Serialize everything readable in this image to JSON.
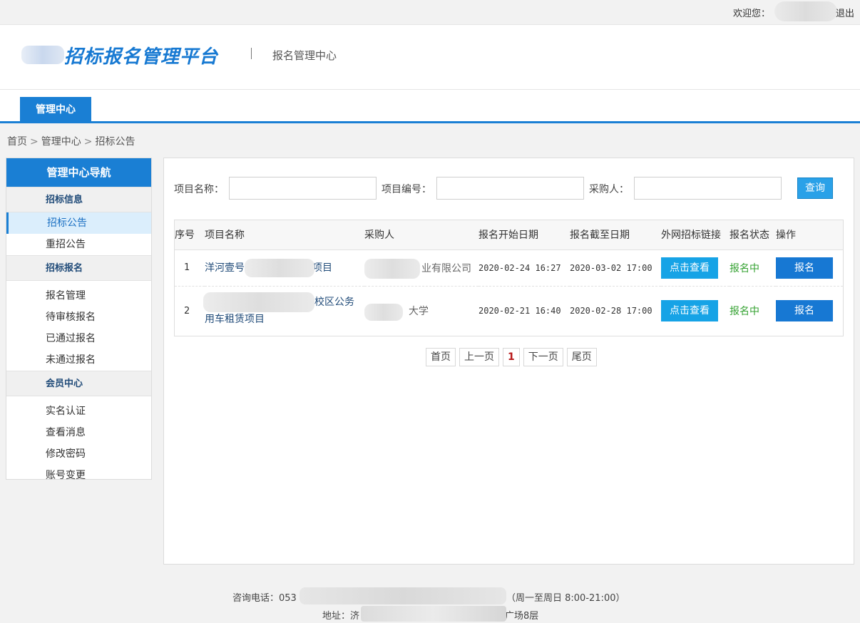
{
  "topbar": {
    "welcome": "欢迎您：",
    "logout": "退出"
  },
  "header": {
    "logo_title": "招标报名管理平台",
    "sub_title": "报名管理中心"
  },
  "nav": {
    "tab": "管理中心"
  },
  "breadcrumb": {
    "home": "首页",
    "center": "管理中心",
    "current": "招标公告",
    "separator": ">"
  },
  "sidebar": {
    "title": "管理中心导航",
    "groups": [
      {
        "title": "招标信息",
        "items": [
          "招标公告",
          "重招公告"
        ]
      },
      {
        "title": "招标报名",
        "items": [
          "报名管理",
          "待审核报名",
          "已通过报名",
          "未通过报名"
        ]
      },
      {
        "title": "会员中心",
        "items": [
          "实名认证",
          "查看消息",
          "修改密码",
          "账号变更"
        ]
      }
    ],
    "active_item": "招标公告"
  },
  "search": {
    "name_label": "项目名称：",
    "code_label": "项目编号：",
    "buyer_label": "采购人：",
    "query_button": "查询",
    "name_value": "",
    "code_value": "",
    "buyer_value": ""
  },
  "table": {
    "headers": [
      "序号",
      "项目名称",
      "采购人",
      "报名开始日期",
      "报名截至日期",
      "外网招标链接",
      "报名状态",
      "操作"
    ],
    "rows": [
      {
        "seq": "1",
        "project_a": "洋河壹号",
        "project_b": "项目",
        "buyer": "业有限公司",
        "start": "2020-02-24 16:27",
        "end": "2020-03-02 17:00",
        "link": "点击查看",
        "status": "报名中",
        "action": "报名"
      },
      {
        "seq": "2",
        "project_a": "校区公务",
        "project_b": "用车租赁项目",
        "buyer": "大学",
        "start": "2020-02-21 16:40",
        "end": "2020-02-28 17:00",
        "link": "点击查看",
        "status": "报名中",
        "action": "报名"
      }
    ]
  },
  "pager": {
    "first": "首页",
    "prev": "上一页",
    "current": "1",
    "next": "下一页",
    "last": "尾页"
  },
  "footer": {
    "phone_label": "咨询电话：053",
    "hours": "（周一至周日 8:00-21:00）",
    "address_label": "地址：济",
    "address_tail": "广场8层"
  },
  "colors": {
    "brand_blue": "#1a7fd4",
    "link_button": "#16a3e6",
    "status_green": "#35a232",
    "page_current": "#b7181a"
  }
}
